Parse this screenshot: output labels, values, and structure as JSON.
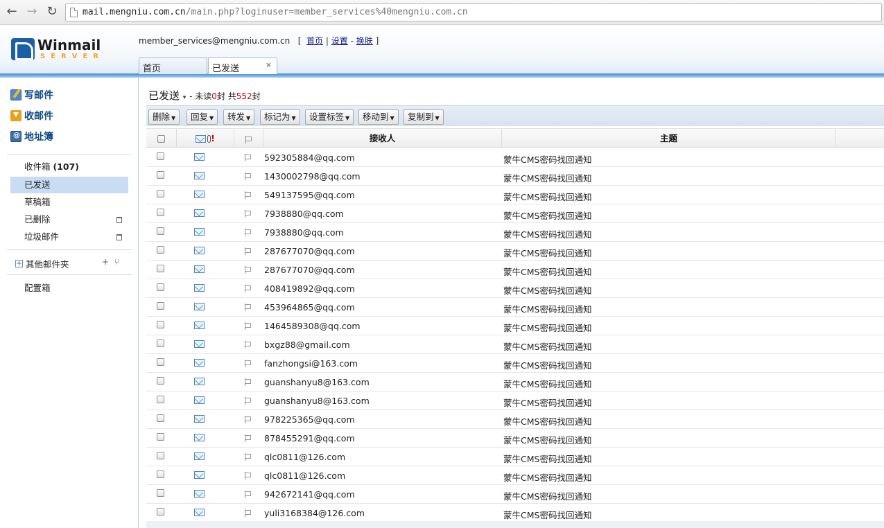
{
  "browser": {
    "url_host": "mail.mengniu.com.cn",
    "url_path": "/main.php?loginuser=member_services%40mengniu.com.cn",
    "back_icon": "back-arrow-icon",
    "forward_icon": "forward-arrow-icon",
    "reload_icon": "reload-icon"
  },
  "header": {
    "logo_word": "Winmail",
    "logo_sub": "SERVER",
    "user": "member_services@mengniu.com.cn",
    "links": [
      "首页",
      "设置",
      "换肤"
    ],
    "open_bracket": "[",
    "close_bracket": "]",
    "sep1": "|",
    "sep2": "-",
    "tabs": [
      {
        "label": "首页"
      },
      {
        "label": "已发送",
        "close": "×"
      }
    ]
  },
  "sidebar": {
    "actions": [
      "写邮件",
      "收邮件",
      "地址簿"
    ],
    "folders": [
      {
        "label": "收件箱",
        "count": "(107)"
      },
      {
        "label": "已发送"
      },
      {
        "label": "草稿箱"
      },
      {
        "label": "已删除"
      },
      {
        "label": "垃圾邮件"
      }
    ],
    "other_folders": "其他邮件夹",
    "other_plus": "+",
    "tool_add": "+",
    "tool_filter": "⑂",
    "config": "配置箱"
  },
  "main": {
    "folder_name": "已发送",
    "caret": "▾",
    "stats_prefix": "- 未读",
    "unread": "0",
    "stats_mid": "封 共",
    "total": "552",
    "stats_suffix": "封",
    "toolbar": [
      "删除",
      "回复",
      "转发",
      "标记为",
      "设置标签",
      "移动到",
      "复制到"
    ],
    "columns": {
      "recipient": "接收人",
      "subject": "主题",
      "priority_mark": "!"
    },
    "rows": [
      {
        "to": "592305884@qq.com",
        "subject": "蒙牛CMS密码找回通知"
      },
      {
        "to": "1430002798@qq.com",
        "subject": "蒙牛CMS密码找回通知"
      },
      {
        "to": "549137595@qq.com",
        "subject": "蒙牛CMS密码找回通知"
      },
      {
        "to": "7938880@qq.com",
        "subject": "蒙牛CMS密码找回通知"
      },
      {
        "to": "7938880@qq.com",
        "subject": "蒙牛CMS密码找回通知"
      },
      {
        "to": "287677070@qq.com",
        "subject": "蒙牛CMS密码找回通知"
      },
      {
        "to": "287677070@qq.com",
        "subject": "蒙牛CMS密码找回通知"
      },
      {
        "to": "408419892@qq.com",
        "subject": "蒙牛CMS密码找回通知"
      },
      {
        "to": "453964865@qq.com",
        "subject": "蒙牛CMS密码找回通知"
      },
      {
        "to": "1464589308@qq.com",
        "subject": "蒙牛CMS密码找回通知"
      },
      {
        "to": "bxgz88@gmail.com",
        "subject": "蒙牛CMS密码找回通知"
      },
      {
        "to": "fanzhongsi@163.com",
        "subject": "蒙牛CMS密码找回通知"
      },
      {
        "to": "guanshanyu8@163.com",
        "subject": "蒙牛CMS密码找回通知"
      },
      {
        "to": "guanshanyu8@163.com",
        "subject": "蒙牛CMS密码找回通知"
      },
      {
        "to": "978225365@qq.com",
        "subject": "蒙牛CMS密码找回通知"
      },
      {
        "to": "878455291@qq.com",
        "subject": "蒙牛CMS密码找回通知"
      },
      {
        "to": "qlc0811@126.com",
        "subject": "蒙牛CMS密码找回通知"
      },
      {
        "to": "qlc0811@126.com",
        "subject": "蒙牛CMS密码找回通知"
      },
      {
        "to": "942672141@qq.com",
        "subject": "蒙牛CMS密码找回通知"
      },
      {
        "to": "yuli3168384@126.com",
        "subject": "蒙牛CMS密码找回通知"
      }
    ]
  },
  "colors": {
    "accent": "#1b5fa8",
    "selected_folder": "#c8dcf4",
    "unread_count": "#cc0000",
    "header_line": "#3c8ed6"
  }
}
